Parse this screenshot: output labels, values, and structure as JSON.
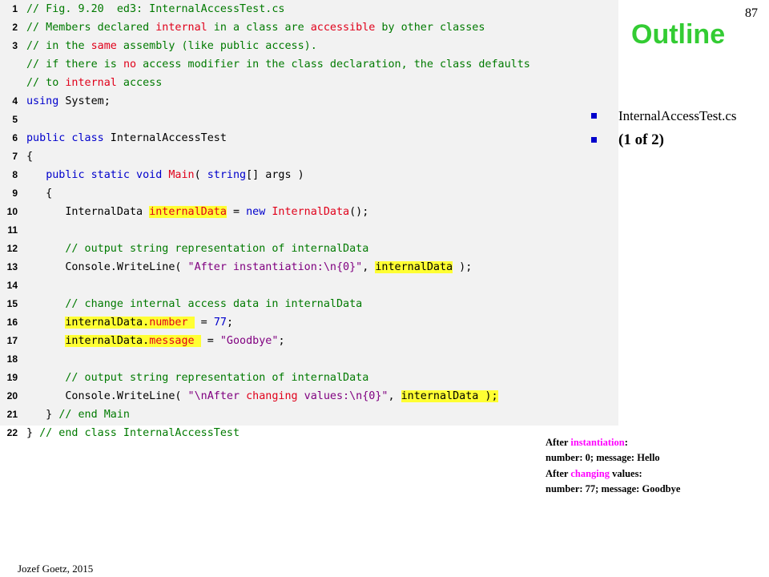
{
  "slide": {
    "title": "Outline",
    "page_number": "87",
    "author": "Jozef Goetz, 2015"
  },
  "bullets": [
    {
      "label": "InternalAccessTest.cs"
    },
    {
      "label": "(1 of 2)"
    }
  ],
  "code_lines": [
    {
      "num": "1",
      "segs": [
        {
          "t": "// Fig. 9.20  ed3: InternalAccessTest.cs",
          "c": "c"
        }
      ]
    },
    {
      "num": "2",
      "segs": [
        {
          "t": "// Members declared ",
          "c": "c"
        },
        {
          "t": "internal",
          "c": "r"
        },
        {
          "t": " in a class are ",
          "c": "c"
        },
        {
          "t": "accessible",
          "c": "r"
        },
        {
          "t": " by other classes",
          "c": "c"
        }
      ]
    },
    {
      "num": "3",
      "segs": [
        {
          "t": "// in the ",
          "c": "c"
        },
        {
          "t": "same",
          "c": "r"
        },
        {
          "t": " assembly (like public access).",
          "c": "c"
        }
      ]
    },
    {
      "num": "",
      "segs": [
        {
          "t": "// if there is ",
          "c": "c"
        },
        {
          "t": "no",
          "c": "r"
        },
        {
          "t": " access modifier in the class declaration, the class defaults",
          "c": "c"
        }
      ]
    },
    {
      "num": "",
      "segs": [
        {
          "t": "// to ",
          "c": "c"
        },
        {
          "t": "internal",
          "c": "r"
        },
        {
          "t": " access",
          "c": "c"
        }
      ]
    },
    {
      "num": "4",
      "segs": [
        {
          "t": "using",
          "c": "k"
        },
        {
          "t": " System;",
          "c": "n"
        }
      ]
    },
    {
      "num": "5",
      "segs": []
    },
    {
      "num": "6",
      "segs": [
        {
          "t": "public class",
          "c": "k"
        },
        {
          "t": " InternalAccessTest",
          "c": "n"
        }
      ]
    },
    {
      "num": "7",
      "segs": [
        {
          "t": "{",
          "c": "n"
        }
      ]
    },
    {
      "num": "8",
      "segs": [
        {
          "t": "   ",
          "c": "n"
        },
        {
          "t": "public static void",
          "c": "k"
        },
        {
          "t": " ",
          "c": "n"
        },
        {
          "t": "Main",
          "c": "r"
        },
        {
          "t": "( ",
          "c": "n"
        },
        {
          "t": "string",
          "c": "k"
        },
        {
          "t": "[] args )",
          "c": "n"
        }
      ]
    },
    {
      "num": "9",
      "segs": [
        {
          "t": "   {",
          "c": "n"
        }
      ]
    },
    {
      "num": "10",
      "segs": [
        {
          "t": "      InternalData ",
          "c": "n"
        },
        {
          "t": "internalData",
          "c": "r",
          "hl": true
        },
        {
          "t": " = ",
          "c": "n"
        },
        {
          "t": "new",
          "c": "k"
        },
        {
          "t": " ",
          "c": "n"
        },
        {
          "t": "InternalData",
          "c": "r"
        },
        {
          "t": "();",
          "c": "n"
        }
      ]
    },
    {
      "num": "11",
      "segs": []
    },
    {
      "num": "12",
      "segs": [
        {
          "t": "      ",
          "c": "n"
        },
        {
          "t": "// output string representation of internalData",
          "c": "c"
        }
      ]
    },
    {
      "num": "13",
      "segs": [
        {
          "t": "      Console.WriteLine( ",
          "c": "n"
        },
        {
          "t": "\"After instantiation:\\n{0}\"",
          "c": "s"
        },
        {
          "t": ", ",
          "c": "n"
        },
        {
          "t": "internalData",
          "c": "n",
          "hl": true
        },
        {
          "t": " );",
          "c": "n"
        }
      ]
    },
    {
      "num": "14",
      "segs": []
    },
    {
      "num": "15",
      "segs": [
        {
          "t": "      ",
          "c": "n"
        },
        {
          "t": "// change internal access data in internalData",
          "c": "c"
        }
      ]
    },
    {
      "num": "16",
      "segs": [
        {
          "t": "      ",
          "c": "n"
        },
        {
          "t": "internalData.",
          "c": "n",
          "hl": true
        },
        {
          "t": "number ",
          "c": "r",
          "hl": true
        },
        {
          "t": " = ",
          "c": "n"
        },
        {
          "t": "77",
          "c": "k"
        },
        {
          "t": ";",
          "c": "n"
        }
      ]
    },
    {
      "num": "17",
      "segs": [
        {
          "t": "      ",
          "c": "n"
        },
        {
          "t": "internalData.",
          "c": "n",
          "hl": true
        },
        {
          "t": "message ",
          "c": "r",
          "hl": true
        },
        {
          "t": " = ",
          "c": "n"
        },
        {
          "t": "\"Goodbye\"",
          "c": "s"
        },
        {
          "t": ";",
          "c": "n"
        }
      ]
    },
    {
      "num": "18",
      "segs": []
    },
    {
      "num": "19",
      "segs": [
        {
          "t": "      ",
          "c": "n"
        },
        {
          "t": "// output string representation of internalData",
          "c": "c"
        }
      ]
    },
    {
      "num": "20",
      "segs": [
        {
          "t": "      Console.WriteLine( ",
          "c": "n"
        },
        {
          "t": "\"\\nAfter ",
          "c": "s"
        },
        {
          "t": "changing",
          "c": "r"
        },
        {
          "t": " values:\\n{0}\"",
          "c": "s"
        },
        {
          "t": ", ",
          "c": "n"
        },
        {
          "t": "internalData );",
          "c": "n",
          "hl": true
        }
      ]
    },
    {
      "num": "21",
      "segs": [
        {
          "t": "   } ",
          "c": "n"
        },
        {
          "t": "// end Main",
          "c": "c"
        }
      ]
    },
    {
      "num": "22",
      "segs": [
        {
          "t": "} ",
          "c": "n"
        },
        {
          "t": "// end class InternalAccessTest",
          "c": "c"
        }
      ]
    }
  ],
  "output_lines": [
    {
      "segs": [
        {
          "t": "After ",
          "c": ""
        },
        {
          "t": "instantiation",
          "c": "pk"
        },
        {
          "t": ":",
          "c": ""
        }
      ]
    },
    {
      "segs": [
        {
          "t": "number: 0; message: Hello",
          "c": ""
        }
      ]
    },
    {
      "segs": [
        {
          "t": "After ",
          "c": ""
        },
        {
          "t": "changing",
          "c": "pk"
        },
        {
          "t": " values:",
          "c": ""
        }
      ]
    },
    {
      "segs": [
        {
          "t": "number: 77; message: Goodbye",
          "c": ""
        }
      ]
    }
  ],
  "colors": {
    "title": "#33cc33",
    "comment": "#007a00",
    "keyword": "#0000cc",
    "emphasis": "#e0001a",
    "string": "#800080",
    "highlight": "#ffff33",
    "output_emphasis": "#ff00ff"
  }
}
